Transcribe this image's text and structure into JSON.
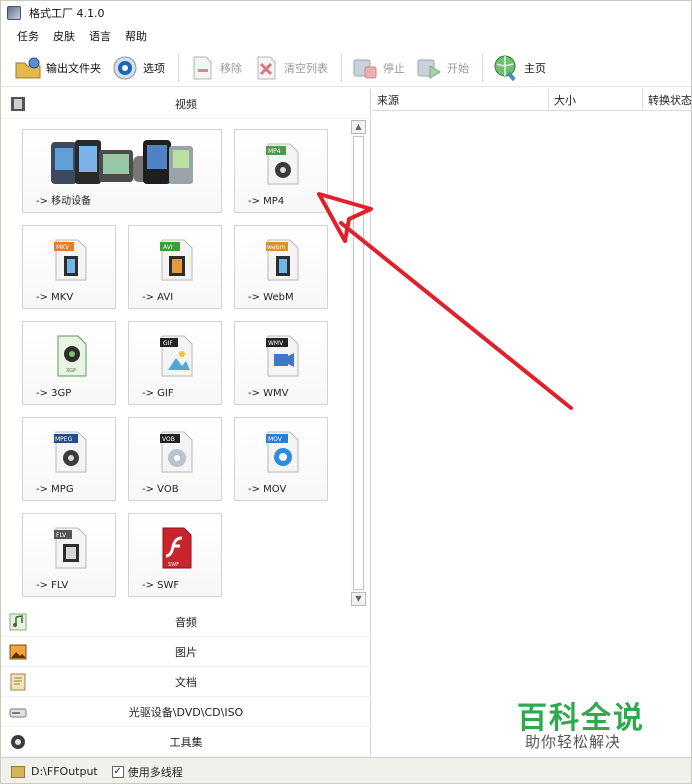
{
  "window": {
    "title": "格式工厂 4.1.0"
  },
  "menu": [
    "任务",
    "皮肤",
    "语言",
    "帮助"
  ],
  "toolbar": {
    "output_folder": "输出文件夹",
    "options": "选项",
    "remove": "移除",
    "clear_list": "清空列表",
    "stop": "停止",
    "start": "开始",
    "home": "主页"
  },
  "categories": {
    "video": "视频",
    "audio": "音频",
    "image": "图片",
    "document": "文档",
    "optical": "光驱设备\\DVD\\CD\\ISO",
    "tools": "工具集"
  },
  "video_formats": [
    {
      "label": "-> 移动设备",
      "badge": ""
    },
    {
      "label": "-> MP4",
      "badge": "MP4"
    },
    {
      "label": "-> MKV",
      "badge": "MKV"
    },
    {
      "label": "-> AVI",
      "badge": "AVI"
    },
    {
      "label": "-> WebM",
      "badge": "webm"
    },
    {
      "label": "-> 3GP",
      "badge": "3GP"
    },
    {
      "label": "-> GIF",
      "badge": "GIF"
    },
    {
      "label": "-> WMV",
      "badge": "WMV"
    },
    {
      "label": "-> MPG",
      "badge": "MPEG"
    },
    {
      "label": "-> VOB",
      "badge": "VOB"
    },
    {
      "label": "-> MOV",
      "badge": "MOV"
    },
    {
      "label": "-> FLV",
      "badge": "FLV"
    },
    {
      "label": "-> SWF",
      "badge": "SWF"
    }
  ],
  "task_columns": [
    "来源",
    "大小",
    "转换状态"
  ],
  "status": {
    "output_path": "D:\\FFOutput",
    "multithread_label": "使用多线程",
    "multithread_checked": true
  },
  "watermark": {
    "title": "百科全说",
    "subtitle": "助你轻松解决"
  },
  "colors": {
    "arrow": "#e0202a",
    "watermark_green": "#2fa84f"
  }
}
